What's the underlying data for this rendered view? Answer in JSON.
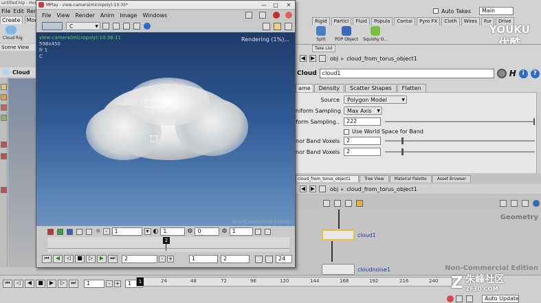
{
  "app": {
    "title_fragment": "untitled.hip - Hou",
    "main_menu": [
      "File",
      "Edit",
      "Ren"
    ],
    "shelf_tab": "Create",
    "shelf_tab2": "Modif",
    "left_tool": "Cloud Rig",
    "scene_view_label": "Scene View",
    "viewport_context": "Cloud",
    "shelf_tools": [
      "Rigid",
      "Particl",
      "Fluid",
      "Popula",
      "Contai",
      "Pyro FX",
      "Cloth",
      "Wires",
      "Fur",
      "Drive"
    ],
    "auto_takes_label": "Auto Takes",
    "desktop_value": "Main",
    "watermark_top": "YOUKU",
    "watermark_top2": "优酷",
    "watermark_bottom": "朱峰社区",
    "watermark_bottom_url": "ZF3D.COM",
    "sub_tools": [
      "Split",
      "POP Object",
      "Squishy O..."
    ]
  },
  "mplay": {
    "title": "MPlay - view-camera(micropoly)-10:35*",
    "menu": [
      "File",
      "View",
      "Render",
      "Anim",
      "Image",
      "Windows"
    ],
    "channel": "C",
    "overlay_camera": "view-camera(micropoly)-10:36:11",
    "overlay_res": "598x450",
    "overlay_frame": "fr 1",
    "overlay_c": "C",
    "status": "Rendering (1%)...",
    "noncommercial": "Non-Commercial Edition",
    "row1_value1": "1",
    "row1_value2": "1",
    "row1_value3": "0",
    "row1_value4": "1",
    "timeline_marker": "2",
    "frame_current": "2",
    "frame_start": "1",
    "frame_end": "2",
    "fps": "24"
  },
  "params": {
    "tab_list_title": "Take List",
    "path": "obj",
    "node_path": "cloud_from_torus_object1",
    "node_type": "Cloud",
    "node_name": "cloud1",
    "tabs": [
      "ame",
      "Density",
      "Scatter Shapes",
      "Flatten"
    ],
    "source_label": "Source",
    "source_value": "Polygon Model",
    "uniform_sampling_label": "niform Sampling",
    "uniform_sampling_value": "Max Axis",
    "form_sampling_label": "form Sampling..",
    "form_sampling_value": "222",
    "use_world_space": "Use World Space for Band",
    "band_voxels_label_1": "nor Band Voxels",
    "band_voxels_value_1": "2",
    "band_voxels_label_2": "nor Band Voxels",
    "band_voxels_value_2": "2"
  },
  "network": {
    "tabs": [
      "cloud_from_torus_object1",
      "Tree View",
      "Material Palette",
      "Asset Browser"
    ],
    "path": "obj",
    "node_path": "cloud_from_torus_object1",
    "context_label": "Geometry",
    "noncommercial": "Non-Commercial Edition",
    "node1": "cloud1",
    "node2": "cloudnoise1"
  },
  "timeline": {
    "current_frame": "1",
    "start_frame": "1",
    "marker": "1",
    "ticks": [
      "24",
      "48",
      "72",
      "96",
      "120",
      "144",
      "168",
      "192",
      "216",
      "240"
    ],
    "auto_update": "Auto Update"
  }
}
